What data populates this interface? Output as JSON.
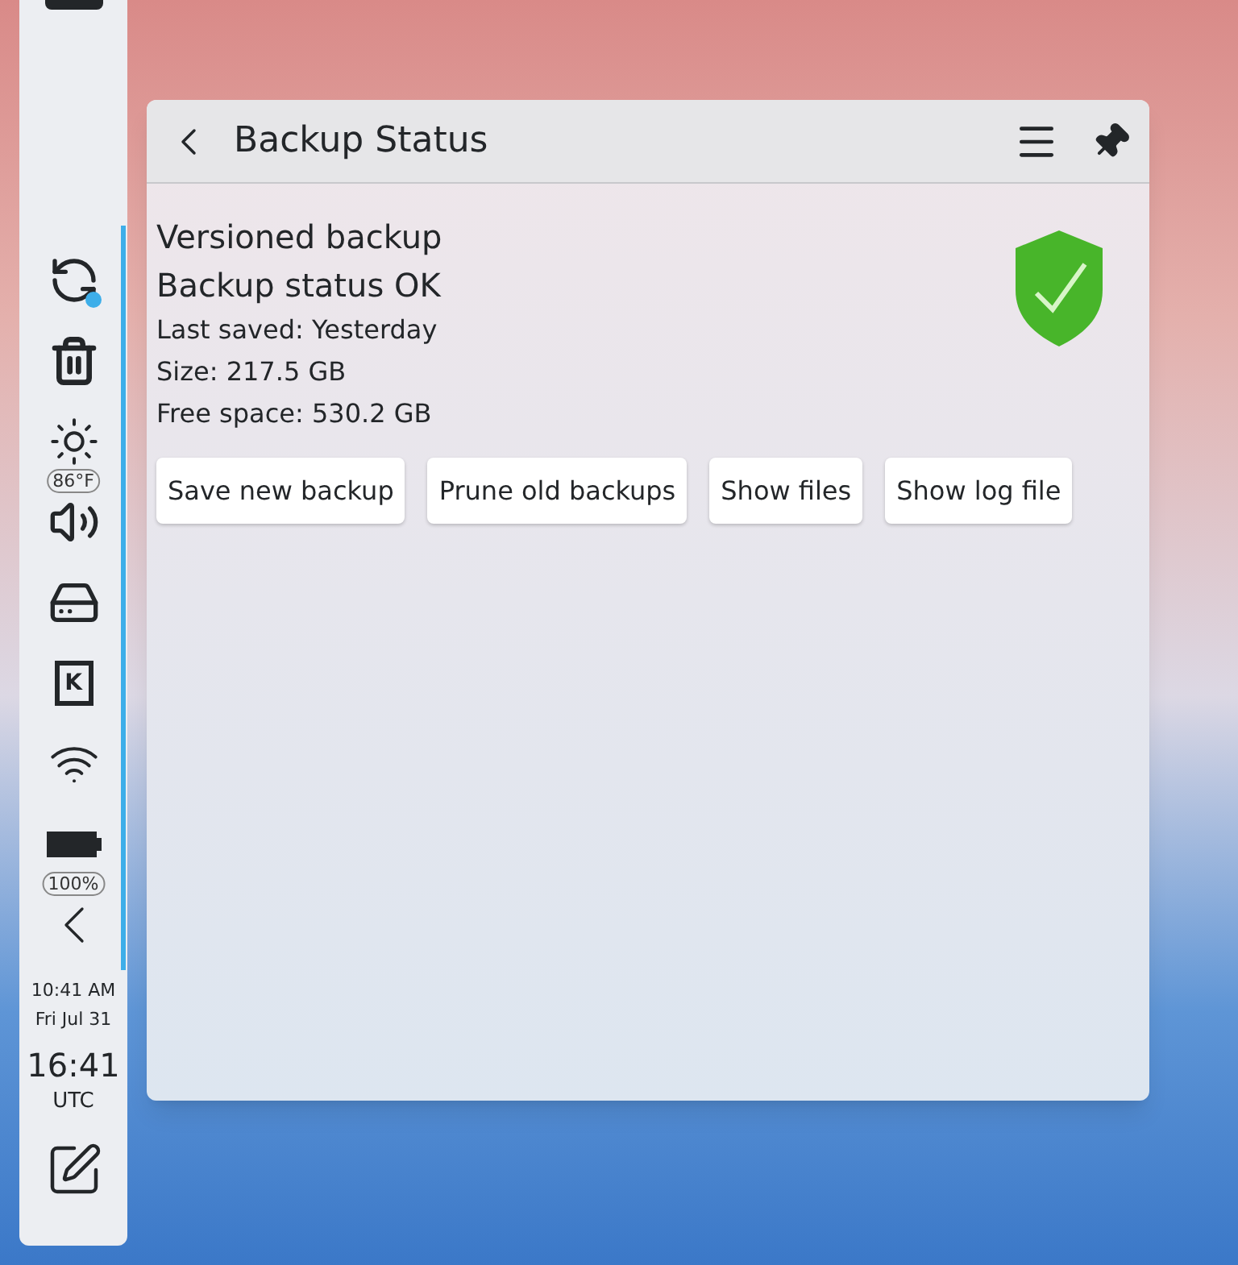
{
  "tray": {
    "active": true,
    "items": [
      {
        "kind": "sync"
      },
      {
        "kind": "trash"
      },
      {
        "kind": "weather",
        "badge": "86°F"
      },
      {
        "kind": "volume"
      },
      {
        "kind": "drive"
      },
      {
        "kind": "letter",
        "label": "K"
      },
      {
        "kind": "wifi"
      },
      {
        "kind": "battery",
        "badge": "100%"
      },
      {
        "kind": "collapse"
      }
    ],
    "clock": {
      "time": "10:41 AM",
      "date": "Fri Jul 31"
    },
    "utc_clock": {
      "time": "16:41",
      "zone": "UTC"
    }
  },
  "popup": {
    "title": "Backup Status",
    "headings": [
      "Versioned backup",
      "Backup status OK"
    ],
    "details": [
      "Last saved: Yesterday",
      "Size: 217.5 GB",
      "Free space: 530.2 GB"
    ],
    "ok": true,
    "buttons": [
      "Save new backup",
      "Prune old backups",
      "Show files",
      "Show log file"
    ]
  }
}
